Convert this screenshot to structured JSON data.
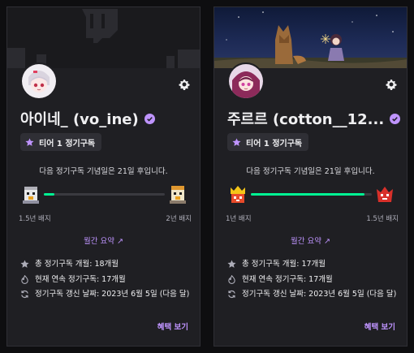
{
  "colors": {
    "accent": "#bf94ff",
    "progress": "#00f593",
    "card_bg": "#1f1f23",
    "page_bg": "#0e0e10"
  },
  "cards": [
    {
      "name": "아이네_ (vo_ine)",
      "tier_label": "티어 1 정기구독",
      "anniversary_text": "다음 정기구독 기념일은 21일 후입니다.",
      "progress_fraction": 0.09,
      "badge_left_label": "1.5년 배지",
      "badge_right_label": "2년 배지",
      "monthly_summary": "월간 요약 ↗",
      "stats": [
        {
          "icon": "star-icon",
          "text": "총 정기구독 개월: 18개월"
        },
        {
          "icon": "flame-icon",
          "text": "현재 연속 정기구독: 17개월"
        },
        {
          "icon": "refresh-icon",
          "text": "정기구독 갱신 날짜: 2023년 6월 5일 (다음 달)"
        }
      ],
      "view_benefits": "혜택 보기",
      "banner_icon": "twitch-glitch-icon"
    },
    {
      "name": "주르르 (cotton__12...",
      "tier_label": "티어 1 정기구독",
      "anniversary_text": "다음 정기구독 기념일은 21일 후입니다.",
      "progress_fraction": 0.94,
      "badge_left_label": "1년 배지",
      "badge_right_label": "1.5년 배지",
      "monthly_summary": "월간 요약 ↗",
      "stats": [
        {
          "icon": "star-icon",
          "text": "총 정기구독 개월: 17개월"
        },
        {
          "icon": "flame-icon",
          "text": "현재 연속 정기구독: 17개월"
        },
        {
          "icon": "refresh-icon",
          "text": "정기구독 갱신 날짜: 2023년 6월 5일 (다음 달)"
        }
      ],
      "view_benefits": "혜택 보기",
      "banner_icon": "night-scene-image"
    }
  ]
}
